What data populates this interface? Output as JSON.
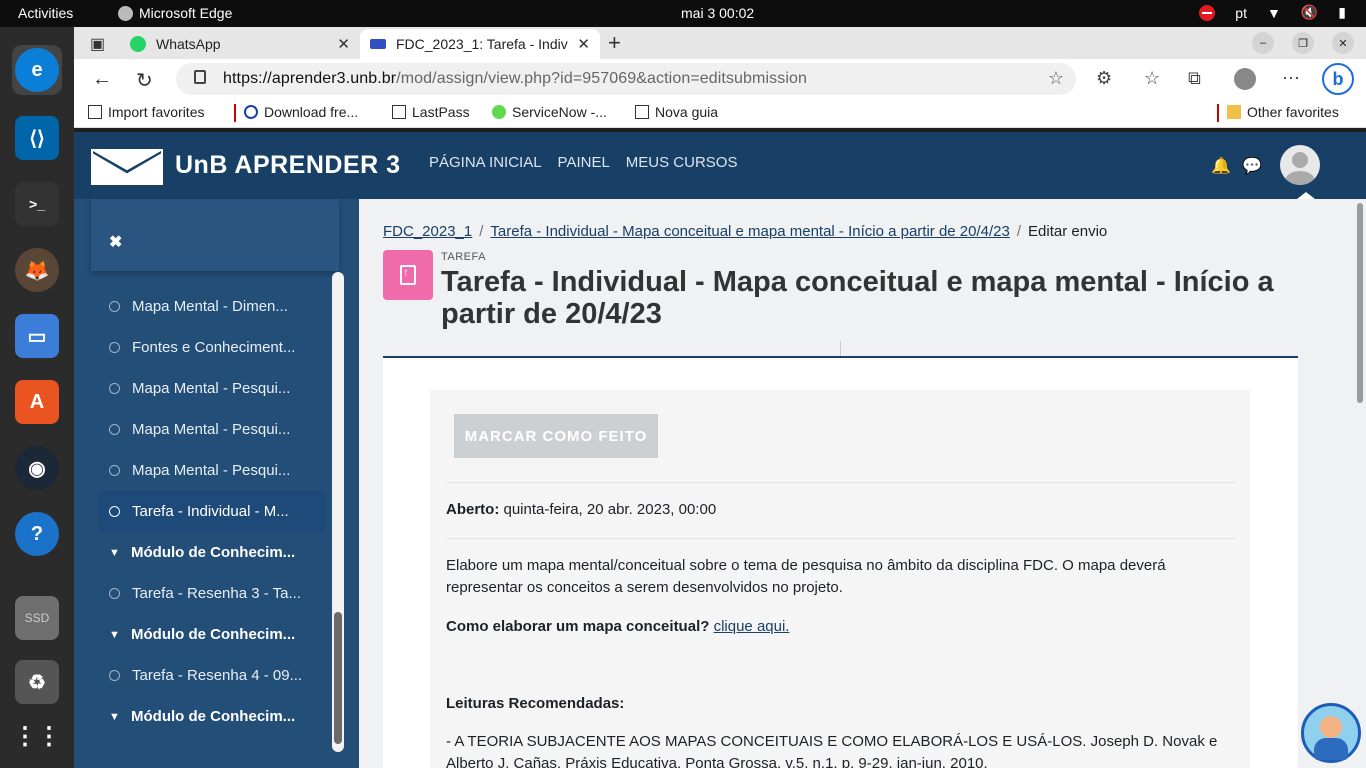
{
  "system": {
    "activities_label": "Activities",
    "app_name": "Microsoft Edge",
    "clock": "mai 3  00:02",
    "language": "pt"
  },
  "dock": {
    "items": [
      {
        "name": "edge-icon",
        "color": "#0078d4"
      },
      {
        "name": "vscode-icon",
        "color": "#0065a9"
      },
      {
        "name": "terminal-icon",
        "color": "#2e2e2e"
      },
      {
        "name": "gimp-icon",
        "color": "#6b4f3a"
      },
      {
        "name": "files-icon",
        "color": "#3b7dd8"
      },
      {
        "name": "app-center-icon",
        "color": "#e95420"
      },
      {
        "name": "steam-icon",
        "color": "#1b2838"
      },
      {
        "name": "help-icon",
        "color": "#1a73c9"
      },
      {
        "name": "ssd-drive-icon",
        "color": "#6e6e6e"
      },
      {
        "name": "trash-icon",
        "color": "#555555"
      },
      {
        "name": "show-apps-icon",
        "color": "#2b2b2b"
      }
    ]
  },
  "browser": {
    "tabs": [
      {
        "label": "WhatsApp"
      },
      {
        "label": "FDC_2023_1: Tarefa - Indiv"
      }
    ],
    "url_host": "https://aprender3.unb.br",
    "url_path": "/mod/assign/view.php?id=957069&action=editsubmission",
    "favorites": [
      {
        "label": "Import favorites"
      },
      {
        "label": "Download fre..."
      },
      {
        "label": "LastPass"
      },
      {
        "label": "ServiceNow -..."
      },
      {
        "label": "Nova guia"
      }
    ],
    "other_favorites": "Other favorites"
  },
  "site": {
    "brand": "UnB  APRENDER 3",
    "nav": [
      "PÁGINA INICIAL",
      "PAINEL",
      "MEUS CURSOS"
    ],
    "colors": {
      "header": "#183f66",
      "drawer": "#234e78",
      "icon_pink": "#ef6bac"
    }
  },
  "drawer": {
    "close_symbol": "✖",
    "items": [
      {
        "label": "Mapa Mental - Dimen...",
        "kind": "activity"
      },
      {
        "label": "Fontes e Conheciment...",
        "kind": "activity"
      },
      {
        "label": "Mapa Mental - Pesqui...",
        "kind": "activity"
      },
      {
        "label": "Mapa Mental - Pesqui...",
        "kind": "activity"
      },
      {
        "label": "Mapa Mental - Pesqui...",
        "kind": "activity"
      },
      {
        "label": "Tarefa - Individual - M...",
        "kind": "activity",
        "active": true
      },
      {
        "label": "Módulo de Conhecim...",
        "kind": "section"
      },
      {
        "label": "Tarefa - Resenha 3 - Ta...",
        "kind": "activity"
      },
      {
        "label": "Módulo de Conhecim...",
        "kind": "section"
      },
      {
        "label": "Tarefa - Resenha 4 - 09...",
        "kind": "activity"
      },
      {
        "label": "Módulo de Conhecim...",
        "kind": "section"
      }
    ]
  },
  "main": {
    "breadcrumb": [
      "FDC_2023_1",
      "Tarefa - Individual - Mapa conceitual e mapa mental - Início a partir de 20/4/23",
      "Editar envio"
    ],
    "type_label": "TAREFA",
    "title": "Tarefa - Individual - Mapa conceitual e mapa mental - Início a partir de 20/4/23",
    "mark_done": "MARCAR COMO FEITO",
    "opened_label": "Aberto:",
    "opened_value": "quinta-feira, 20 abr. 2023, 00:00",
    "description": "Elabore um mapa mental/conceitual sobre o tema de pesquisa  no âmbito da disciplina FDC. O mapa deverá representar os conceitos a serem desenvolvidos no projeto.",
    "howto_label": "Como elaborar um mapa conceitual?",
    "howto_link": "clique aqui.",
    "readings_title": "Leituras Recomendadas:",
    "reading_1": "- A TEORIA SUBJACENTE AOS MAPAS CONCEITUAIS E COMO ELABORÁ-LOS E USÁ-LOS. Joseph D. Novak e Alberto J. Cañas. Práxis Educativa, Ponta Grossa, v.5, n.1, p. 9-29, jan-jun. 2010."
  }
}
